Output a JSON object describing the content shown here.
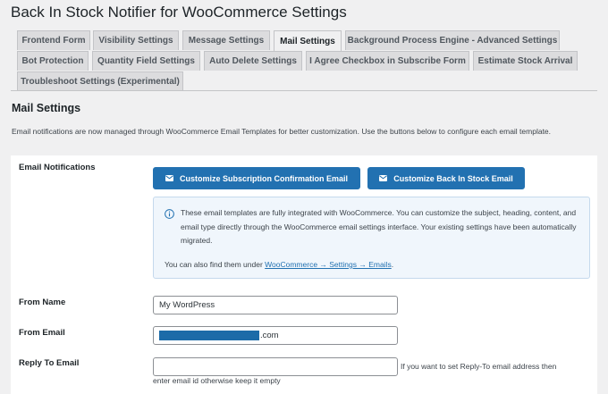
{
  "page": {
    "title": "Back In Stock Notifier for WooCommerce Settings"
  },
  "tabs": [
    {
      "label": "Frontend Form"
    },
    {
      "label": "Visibility Settings"
    },
    {
      "label": "Message Settings"
    },
    {
      "label": "Mail Settings",
      "active": true
    },
    {
      "label": "Background Process Engine - Advanced Settings"
    },
    {
      "label": "Bot Protection"
    },
    {
      "label": "Quantity Field Settings"
    },
    {
      "label": "Auto Delete Settings"
    },
    {
      "label": "I Agree Checkbox in Subscribe Form"
    },
    {
      "label": "Estimate Stock Arrival"
    },
    {
      "label": "Troubleshoot Settings (Experimental)"
    }
  ],
  "section": {
    "title": "Mail Settings",
    "description": "Email notifications are now managed through WooCommerce Email Templates for better customization. Use the buttons below to configure each email template."
  },
  "email_notifications": {
    "label": "Email Notifications",
    "button_subscription": "Customize Subscription Confirmation Email",
    "button_back_in_stock": "Customize Back In Stock Email",
    "button_icon": "envelope-icon",
    "notice_icon": "info-icon",
    "notice_text": "These email templates are fully integrated with WooCommerce. You can customize the subject, heading, content, and email type directly through the WooCommerce email settings interface. Your existing settings have been automatically migrated.",
    "notice_find_prefix": "You can also find them under ",
    "notice_link": "WooCommerce → Settings → Emails",
    "notice_find_suffix": "."
  },
  "from_name": {
    "label": "From Name",
    "value": "My WordPress"
  },
  "from_email": {
    "label": "From Email",
    "value_suffix": ".com"
  },
  "reply_to": {
    "label": "Reply To Email",
    "value": "",
    "help_line1": "If you want to set Reply-To email address then",
    "help_line2": "enter email id otherwise keep it empty"
  },
  "colors": {
    "primary": "#2271b1",
    "background": "#f0f0f1",
    "notice_bg": "#f0f6fc"
  }
}
